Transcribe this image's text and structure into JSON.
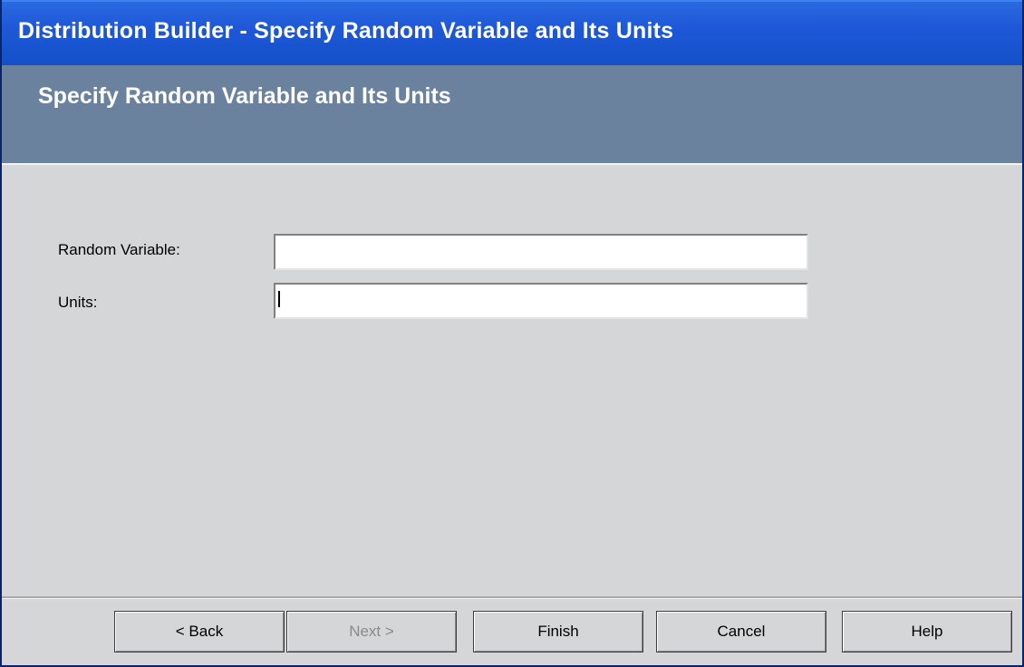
{
  "window": {
    "title": "Distribution Builder - Specify Random Variable and Its Units"
  },
  "header": {
    "title": "Specify Random Variable and Its Units"
  },
  "form": {
    "random_variable": {
      "label": "Random Variable:",
      "value": ""
    },
    "units": {
      "label": "Units:",
      "value": ""
    }
  },
  "buttons": {
    "back": "< Back",
    "next": "Next >",
    "finish": "Finish",
    "cancel": "Cancel",
    "help": "Help"
  },
  "colors": {
    "title_bar": "#1e58d8",
    "header_band": "#6a829e",
    "dialog_background": "#d4d6d8"
  }
}
